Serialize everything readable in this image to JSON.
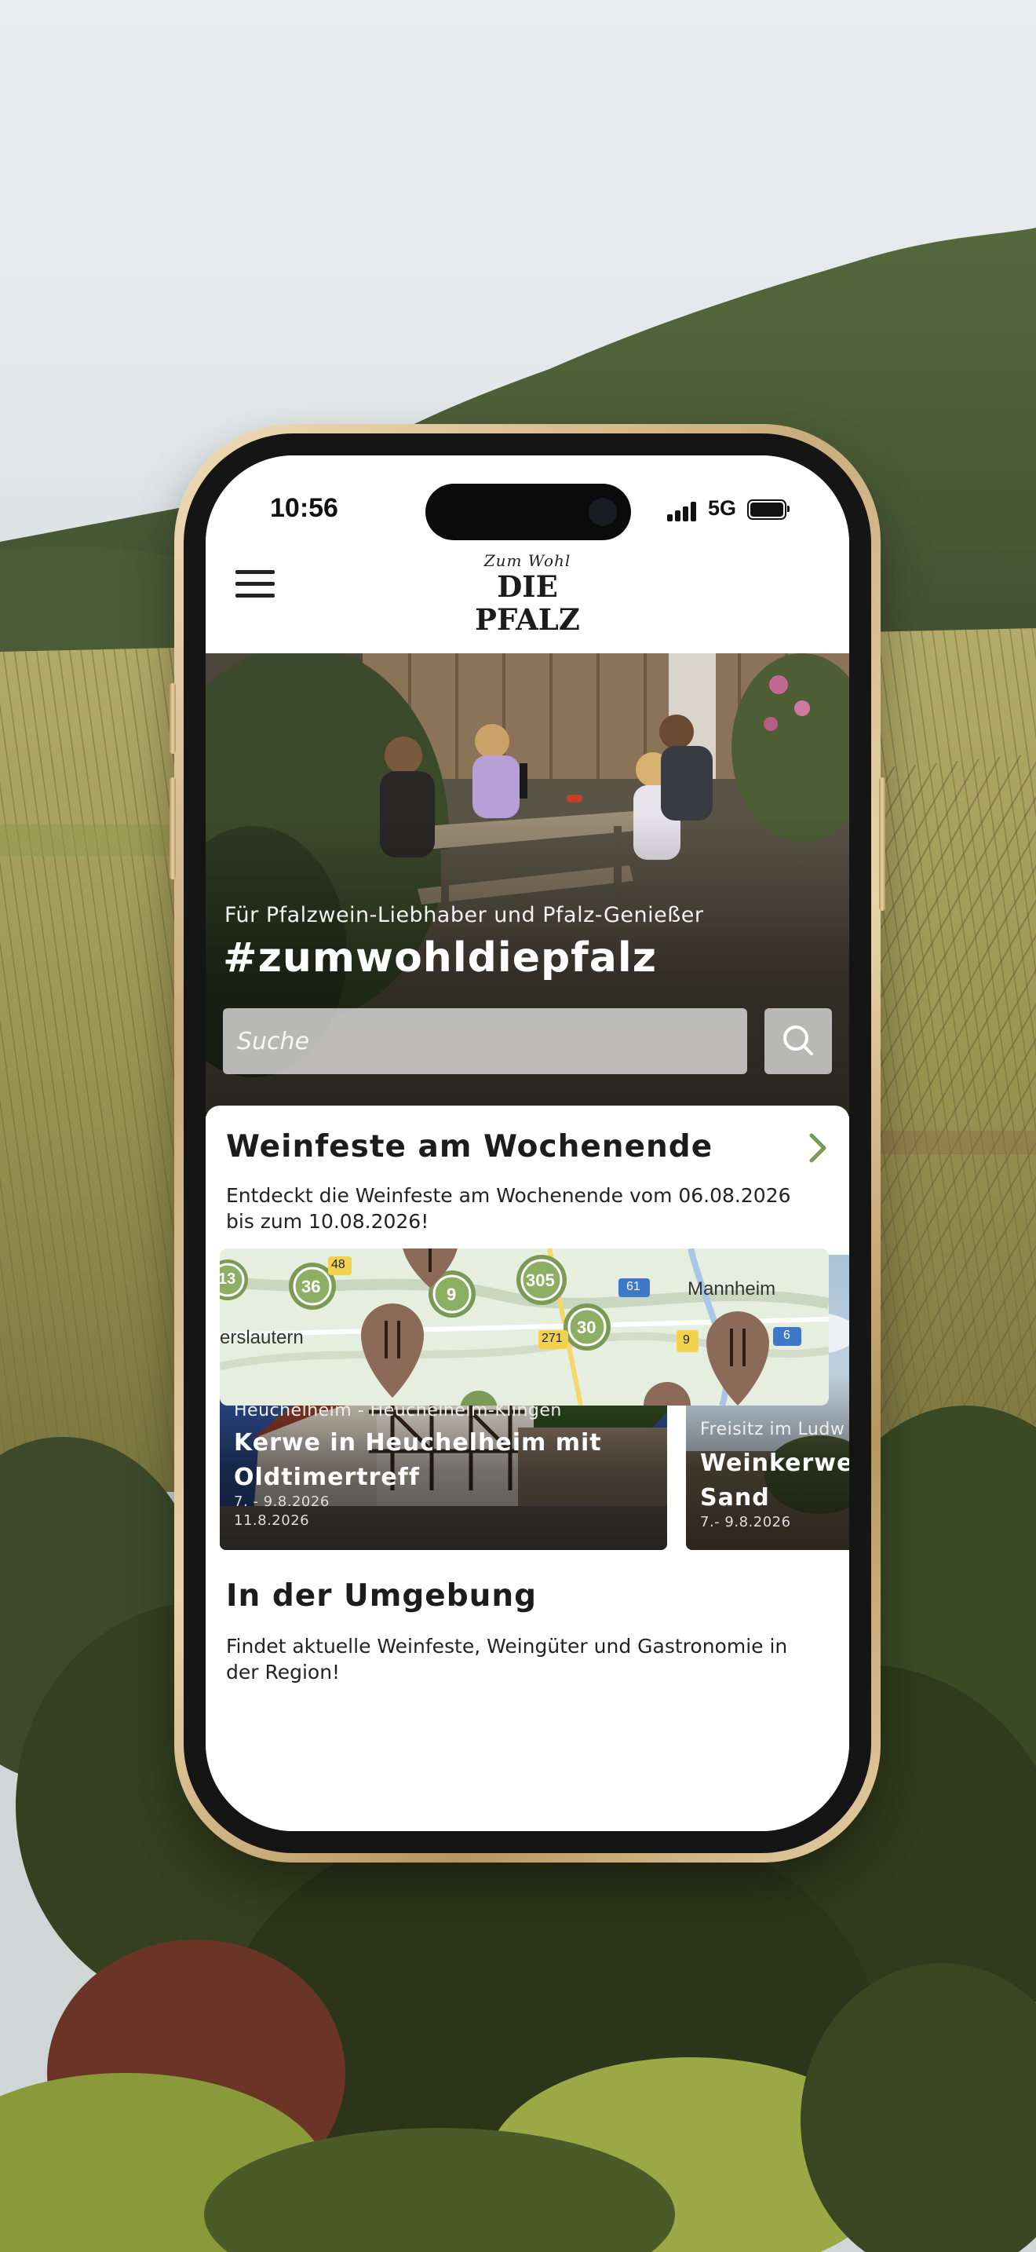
{
  "status_bar": {
    "time": "10:56",
    "network": "5G"
  },
  "header": {
    "logo_script": "Zum Wohl",
    "logo_main": "DIE PFALZ"
  },
  "hero": {
    "subtitle": "Für Pfalzwein-Liebhaber und Pfalz-Genießer",
    "title": "#zumwohldiepfalz",
    "search_placeholder": "Suche"
  },
  "weinfeste": {
    "title": "Weinfeste am Wochenende",
    "description": "Entdeckt die Weinfeste am Wochenende vom 06.08.2026 bis zum 10.08.2026!",
    "events": [
      {
        "place": "Heuchelheim - Heuchelheim-Klingen",
        "name": "Kerwe in Heuchelheim mit Oldtimertreff",
        "dates": [
          "7. - 9.8.2026",
          "11.8.2026"
        ],
        "favorite": true
      },
      {
        "place": "Freisitz im Ludw",
        "name": "Weinkerwe Sand",
        "dates": [
          "7.- 9.8.2026"
        ],
        "favorite": false
      }
    ]
  },
  "umgebung": {
    "title": "In der Umgebung",
    "description": "Findet aktuelle Weinfeste, Weingüter und Gastronomie in der Region!"
  },
  "map": {
    "city_labels": [
      "Mannheim",
      "erslautern"
    ],
    "cluster_counts": [
      "13",
      "36",
      "9",
      "305",
      "30"
    ],
    "road_labels": [
      "48",
      "61",
      "6",
      "271",
      "9"
    ]
  },
  "colors": {
    "accent_green": "#7a9a55",
    "marker_brown": "#8b6a57",
    "text_dark": "#1c1c1c"
  }
}
